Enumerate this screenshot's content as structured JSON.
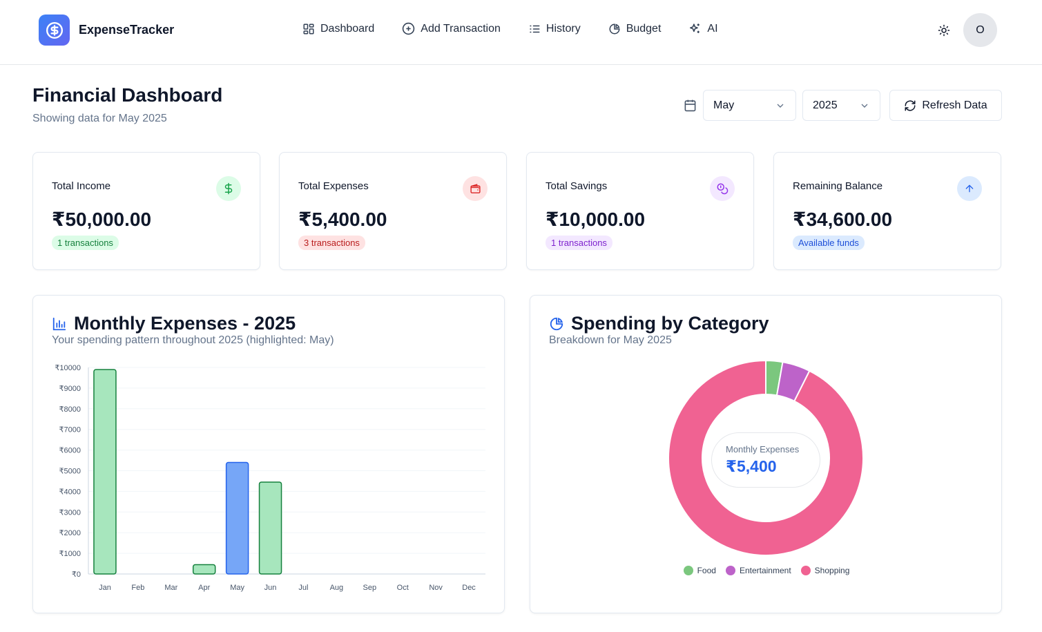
{
  "header": {
    "brand": "ExpenseTracker",
    "nav": [
      {
        "label": "Dashboard",
        "icon": "dashboard-icon"
      },
      {
        "label": "Add Transaction",
        "icon": "plus-circle-icon"
      },
      {
        "label": "History",
        "icon": "list-icon"
      },
      {
        "label": "Budget",
        "icon": "pie-icon"
      },
      {
        "label": "AI",
        "icon": "sparkles-icon"
      }
    ],
    "avatar_initial": "O"
  },
  "page": {
    "title": "Financial Dashboard",
    "subtitle": "Showing data for May 2025",
    "month": "May",
    "year": "2025",
    "refresh_label": "Refresh Data"
  },
  "cards": [
    {
      "label": "Total Income",
      "value": "₹50,000.00",
      "badge": "1 transactions",
      "color": "#16a34a",
      "icon": "dollar-icon"
    },
    {
      "label": "Total Expenses",
      "value": "₹5,400.00",
      "badge": "3 transactions",
      "color": "#dc2626",
      "icon": "wallet-icon"
    },
    {
      "label": "Total Savings",
      "value": "₹10,000.00",
      "badge": "1 transactions",
      "color": "#9333ea",
      "icon": "coins-icon"
    },
    {
      "label": "Remaining Balance",
      "value": "₹34,600.00",
      "badge": "Available funds",
      "color": "#2563eb",
      "icon": "arrow-up-icon"
    }
  ],
  "bar_panel": {
    "title": "Monthly Expenses - 2025",
    "subtitle": "Your spending pattern throughout 2025 (highlighted: May)"
  },
  "pie_panel": {
    "title": "Spending by Category",
    "subtitle": "Breakdown for May 2025",
    "center_label": "Monthly Expenses",
    "center_value": "₹5,400"
  },
  "chart_data": [
    {
      "type": "bar",
      "categories": [
        "Jan",
        "Feb",
        "Mar",
        "Apr",
        "May",
        "Jun",
        "Jul",
        "Aug",
        "Sep",
        "Oct",
        "Nov",
        "Dec"
      ],
      "values": [
        9900,
        0,
        0,
        450,
        5400,
        4450,
        0,
        0,
        0,
        0,
        0,
        0
      ],
      "highlight": "May",
      "ylim": [
        0,
        10000
      ],
      "yticks": [
        "₹0",
        "₹1000",
        "₹2000",
        "₹3000",
        "₹4000",
        "₹5000",
        "₹6000",
        "₹7000",
        "₹8000",
        "₹9000",
        "₹10000"
      ],
      "colors": {
        "default_fill": "#a7e6bd",
        "default_stroke": "#15803d",
        "highlight_fill": "#76a6f7",
        "highlight_stroke": "#2563eb"
      }
    },
    {
      "type": "pie",
      "labels": [
        "Food",
        "Entertainment",
        "Shopping"
      ],
      "values": [
        150,
        250,
        5000
      ],
      "colors": [
        "#7bc77e",
        "#bd63c9",
        "#f06292"
      ],
      "legend": "bottom"
    }
  ]
}
